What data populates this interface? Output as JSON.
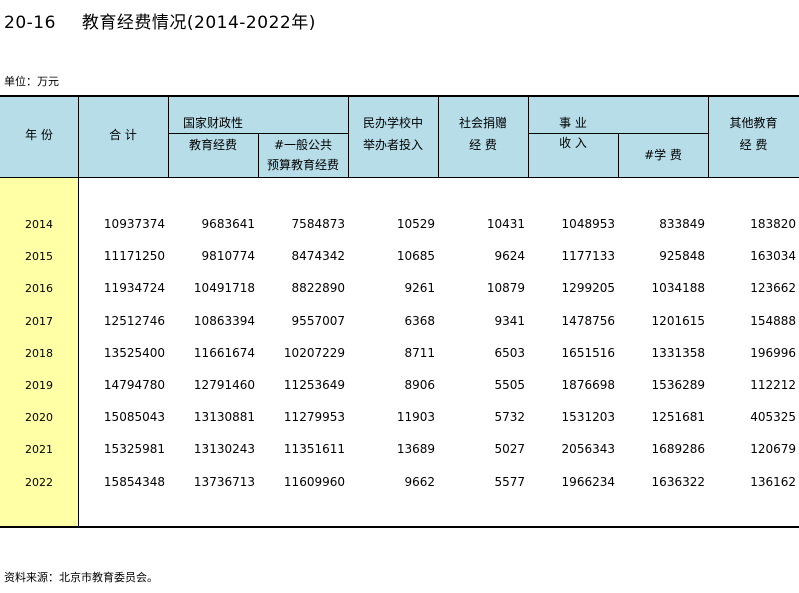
{
  "title": {
    "number": "20-16",
    "text": "教育经费情况(2014-2022年)"
  },
  "unit": "单位：万元",
  "headers": {
    "year": "年  份",
    "total": "合  计",
    "gov_line1": "国家财政性",
    "gov_line2": "教育经费",
    "gov_sub_line1": "#一般公共",
    "gov_sub_line2": "预算教育经费",
    "private_line1": "民办学校中",
    "private_line2": "举办者投入",
    "donation_line1": "社会捐赠",
    "donation_line2": "经    费",
    "business_line1": "事  业",
    "business_line2": "收  入",
    "tuition": "#学  费",
    "other_line1": "其他教育",
    "other_line2": "经    费"
  },
  "rows": [
    {
      "year": "2014",
      "total": "10937374",
      "gov": "9683641",
      "budget": "7584873",
      "private": "10529",
      "donation": "10431",
      "business": "1048953",
      "tuition": "833849",
      "other": "183820"
    },
    {
      "year": "2015",
      "total": "11171250",
      "gov": "9810774",
      "budget": "8474342",
      "private": "10685",
      "donation": "9624",
      "business": "1177133",
      "tuition": "925848",
      "other": "163034"
    },
    {
      "year": "2016",
      "total": "11934724",
      "gov": "10491718",
      "budget": "8822890",
      "private": "9261",
      "donation": "10879",
      "business": "1299205",
      "tuition": "1034188",
      "other": "123662"
    },
    {
      "year": "2017",
      "total": "12512746",
      "gov": "10863394",
      "budget": "9557007",
      "private": "6368",
      "donation": "9341",
      "business": "1478756",
      "tuition": "1201615",
      "other": "154888"
    },
    {
      "year": "2018",
      "total": "13525400",
      "gov": "11661674",
      "budget": "10207229",
      "private": "8711",
      "donation": "6503",
      "business": "1651516",
      "tuition": "1331358",
      "other": "196996"
    },
    {
      "year": "2019",
      "total": "14794780",
      "gov": "12791460",
      "budget": "11253649",
      "private": "8906",
      "donation": "5505",
      "business": "1876698",
      "tuition": "1536289",
      "other": "112212"
    },
    {
      "year": "2020",
      "total": "15085043",
      "gov": "13130881",
      "budget": "11279953",
      "private": "11903",
      "donation": "5732",
      "business": "1531203",
      "tuition": "1251681",
      "other": "405325"
    },
    {
      "year": "2021",
      "total": "15325981",
      "gov": "13130243",
      "budget": "11351611",
      "private": "13689",
      "donation": "5027",
      "business": "2056343",
      "tuition": "1689286",
      "other": "120679"
    },
    {
      "year": "2022",
      "total": "15854348",
      "gov": "13736713",
      "budget": "11609960",
      "private": "9662",
      "donation": "5577",
      "business": "1966234",
      "tuition": "1636322",
      "other": "136162"
    }
  ],
  "source": "资料来源：北京市教育委员会。"
}
